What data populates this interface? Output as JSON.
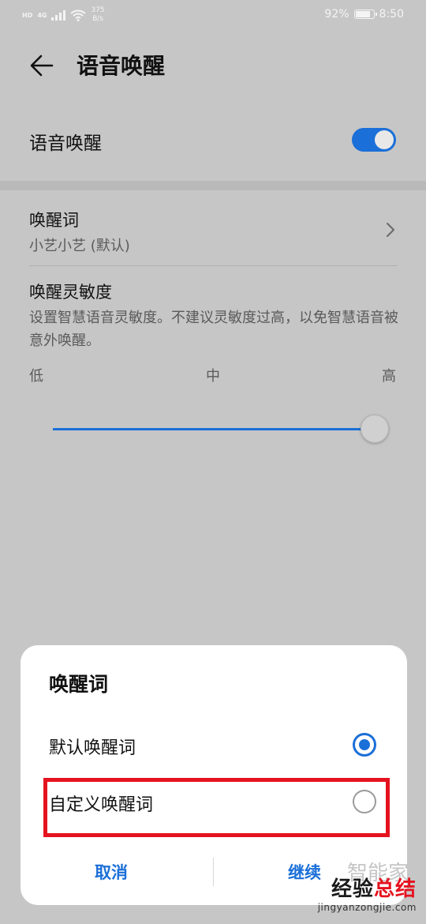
{
  "status_bar": {
    "network_tag": "HD",
    "network_type": "4G",
    "speed_value": "375",
    "speed_unit": "B/s",
    "battery_percent": "92%",
    "battery_level": 0.92,
    "time": "8:50"
  },
  "header": {
    "title": "语音唤醒",
    "back_icon": "arrow-left-icon"
  },
  "main_switch": {
    "label": "语音唤醒",
    "enabled": true
  },
  "wake_word": {
    "title": "唤醒词",
    "value": "小艺小艺 (默认)"
  },
  "sensitivity": {
    "title": "唤醒灵敏度",
    "description": "设置智慧语音灵敏度。不建议灵敏度过高，以免智慧语音被意外唤醒。",
    "low_label": "低",
    "mid_label": "中",
    "high_label": "高",
    "level": 1.0
  },
  "dialog": {
    "title": "唤醒词",
    "options": [
      {
        "label": "默认唤醒词",
        "selected": true
      },
      {
        "label": "自定义唤醒词",
        "selected": false
      }
    ],
    "cancel_label": "取消",
    "continue_label": "继续"
  },
  "watermark": {
    "faint_text": "智能家",
    "text_a": "经验",
    "text_b": "总结",
    "url": "jingyanzongjie.com"
  },
  "colors": {
    "accent": "#1a6fd8",
    "highlight": "#e5121f",
    "overlay_background": "#c6c6c6"
  }
}
